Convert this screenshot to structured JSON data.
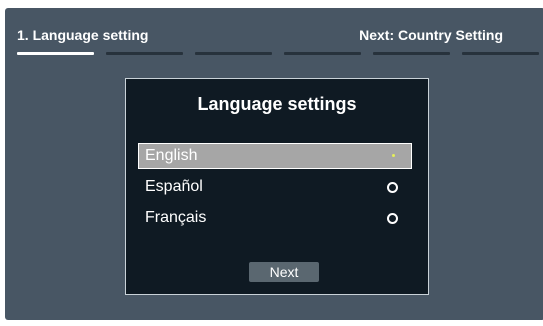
{
  "header": {
    "current_step": "1. Language setting",
    "next_step": "Next: Country Setting"
  },
  "progress": {
    "total_steps": 6,
    "current_step_index": 1
  },
  "dialog": {
    "title": "Language settings",
    "options": [
      {
        "label": "English",
        "selected": true
      },
      {
        "label": "Español",
        "selected": false
      },
      {
        "label": "Français",
        "selected": false
      }
    ],
    "next_label": "Next"
  },
  "colors": {
    "background": "#485664",
    "dialog_bg": "#0f1a23",
    "selection_bg": "#a6a6a6",
    "selected_dot": "#e4ef5a"
  }
}
